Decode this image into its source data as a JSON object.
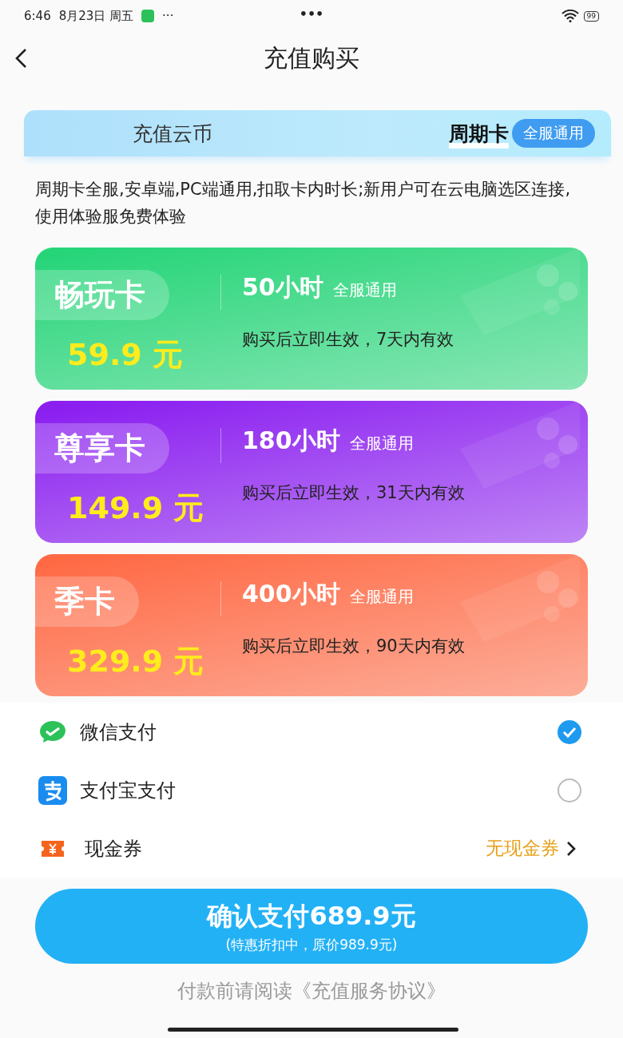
{
  "status_bar": {
    "time": "6:46",
    "date": "8月23日 周五",
    "more": "···",
    "center": "•••",
    "battery": "99"
  },
  "header": {
    "title": "充值购买"
  },
  "tabs": [
    {
      "label": "充值云币",
      "selected": false
    },
    {
      "label": "周期卡",
      "selected": true,
      "badge": "全服通用"
    }
  ],
  "description": "周期卡全服,安卓端,PC端通用,扣取卡内时长;新用户可在云电脑选区连接,使用体验服免费体验",
  "cards": [
    {
      "name": "畅玩卡",
      "price": "59.9 元",
      "hours": "50小时",
      "scope": "全服通用",
      "validity": "购买后立即生效，7天内有效",
      "color": "#27d579"
    },
    {
      "name": "尊享卡",
      "price": "149.9 元",
      "hours": "180小时",
      "scope": "全服通用",
      "validity": "购买后立即生效，31天内有效",
      "color": "#8b1ff0"
    },
    {
      "name": "季卡",
      "price": "329.9 元",
      "hours": "400小时",
      "scope": "全服通用",
      "validity": "购买后立即生效，90天内有效",
      "color": "#ff6a45"
    }
  ],
  "payment_methods": [
    {
      "kind": "wechat",
      "label": "微信支付",
      "selected": true
    },
    {
      "kind": "alipay",
      "label": "支付宝支付",
      "selected": false
    }
  ],
  "voucher": {
    "label": "现金券",
    "value": "无现金券"
  },
  "confirm": {
    "label": "确认支付689.9元",
    "note": "(特惠折扣中，原价989.9元)"
  },
  "agreement": {
    "text": "付款前请阅读",
    "link": "《充值服务协议》"
  }
}
